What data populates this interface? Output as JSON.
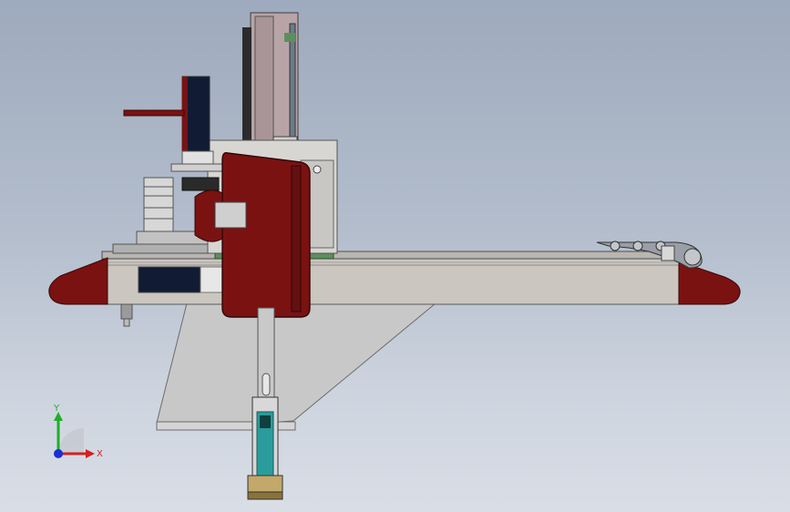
{
  "view": {
    "background_top": "#9eaabd",
    "background_bottom": "#d9dee6"
  },
  "triad": {
    "x_label": "X",
    "y_label": "Y",
    "x_color": "#d42020",
    "y_color": "#1fae2a",
    "z_color": "#1a2fd6"
  },
  "model": {
    "accent_color": "#7a1212",
    "frame_color": "#c9c4bd",
    "guard_color": "#111b33",
    "rail_color": "#5c8f5e",
    "cylinder_color": "#2a9c9c"
  }
}
